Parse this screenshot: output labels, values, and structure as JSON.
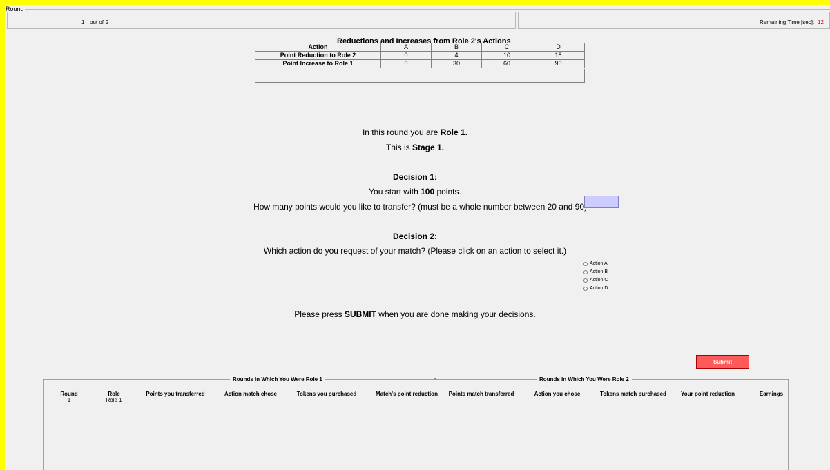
{
  "header": {
    "round_legend": "Round",
    "round_current": "1",
    "round_of": "out of",
    "round_total": "2",
    "time_label": "Remaining Time [sec]:",
    "time_value": "12"
  },
  "table": {
    "title": "Reductions and Increases from Role 2's Actions",
    "header": [
      "Action",
      "A",
      "B",
      "C",
      "D"
    ],
    "rows": [
      {
        "label": "Point Reduction to Role 2",
        "values": [
          "0",
          "4",
          "10",
          "18"
        ]
      },
      {
        "label": "Point Increase to Role 1",
        "values": [
          "0",
          "30",
          "60",
          "90"
        ]
      }
    ]
  },
  "main": {
    "role_prefix": "In this round you are ",
    "role_value": "Role 1.",
    "stage_prefix": "This is ",
    "stage_value": "Stage 1.",
    "decision1_title": "Decision 1:",
    "start_prefix": "You start with ",
    "start_points": "100",
    "start_suffix": " points.",
    "transfer_question": "How many points would you like to transfer? (must be a whole number between 20 and 90)",
    "transfer_value": "",
    "decision2_title": "Decision 2:",
    "action_question": "Which action do you request of your match? (Please click on an action to select it.)",
    "actions": [
      "Action A",
      "Action B",
      "Action C",
      "Action D"
    ],
    "submit_prefix": "Please press ",
    "submit_word": "SUBMIT",
    "submit_suffix": " when you are done making your decisions."
  },
  "submit_button": "Submit",
  "history": {
    "group_role1": "Rounds In Which You Were Role 1",
    "group_separator": "-",
    "group_role2": "Rounds In Which You Were Role 2",
    "columns": [
      "Round",
      "Role",
      "Points you transferred",
      "Action match chose",
      "Tokens you purchased",
      "Match's point reduction",
      "Points match transferred",
      "Action you chose",
      "Tokens match purchased",
      "Your point reduction",
      "Earnings"
    ],
    "rows": [
      {
        "round": "1",
        "role": "Role 1"
      }
    ]
  },
  "colors": {
    "frame": "#ffff00",
    "background": "#f0f0f0",
    "input_fill": "#ccccff",
    "submit_fill": "#ff5a5a",
    "timer_text": "#e00000"
  }
}
